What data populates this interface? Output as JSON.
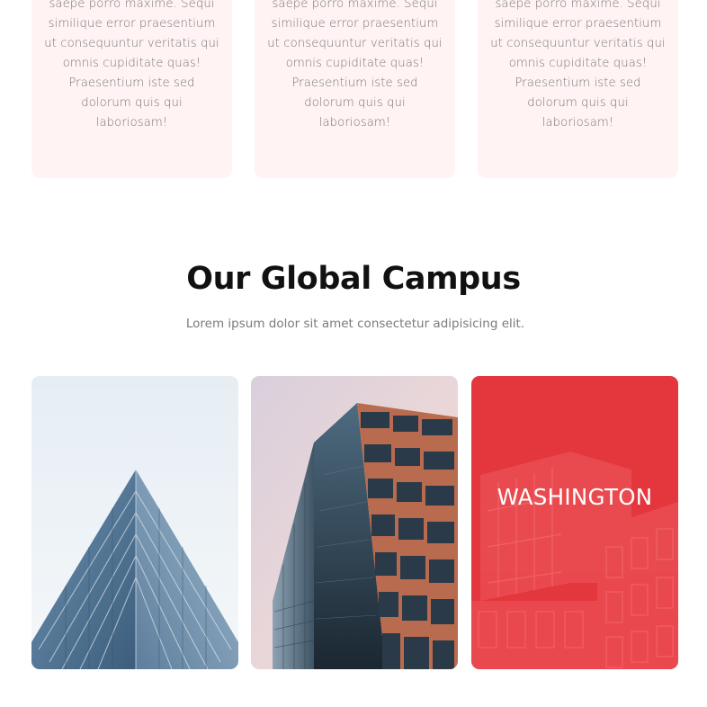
{
  "feature_cards": [
    {
      "text": "saepe porro maxime. Sequi similique error praesentium ut consequuntur veritatis qui omnis cupiditate quas! Praesentium iste sed dolorum quis qui laboriosam!"
    },
    {
      "text": "saepe porro maxime. Sequi similique error praesentium ut consequuntur veritatis qui omnis cupiditate quas! Praesentium iste sed dolorum quis qui laboriosam!"
    },
    {
      "text": "saepe porro maxime. Sequi similique error praesentium ut consequuntur veritatis qui omnis cupiditate quas! Praesentium iste sed dolorum quis qui laboriosam!"
    }
  ],
  "campus": {
    "title": "Our Global Campus",
    "subtitle": "Lorem ipsum dolor sit amet consectetur adipisicing elit.",
    "cards": [
      {
        "image": "glass-tower-photo",
        "label": ""
      },
      {
        "image": "office-building-photo",
        "label": ""
      },
      {
        "image": "apartment-building-photo",
        "label": "WASHINGTON",
        "overlay_color": "#e8363c"
      }
    ]
  },
  "colors": {
    "card_background": "#fff3f3",
    "body_text": "#77777a",
    "heading": "#111111",
    "accent_overlay": "#e8363c"
  }
}
